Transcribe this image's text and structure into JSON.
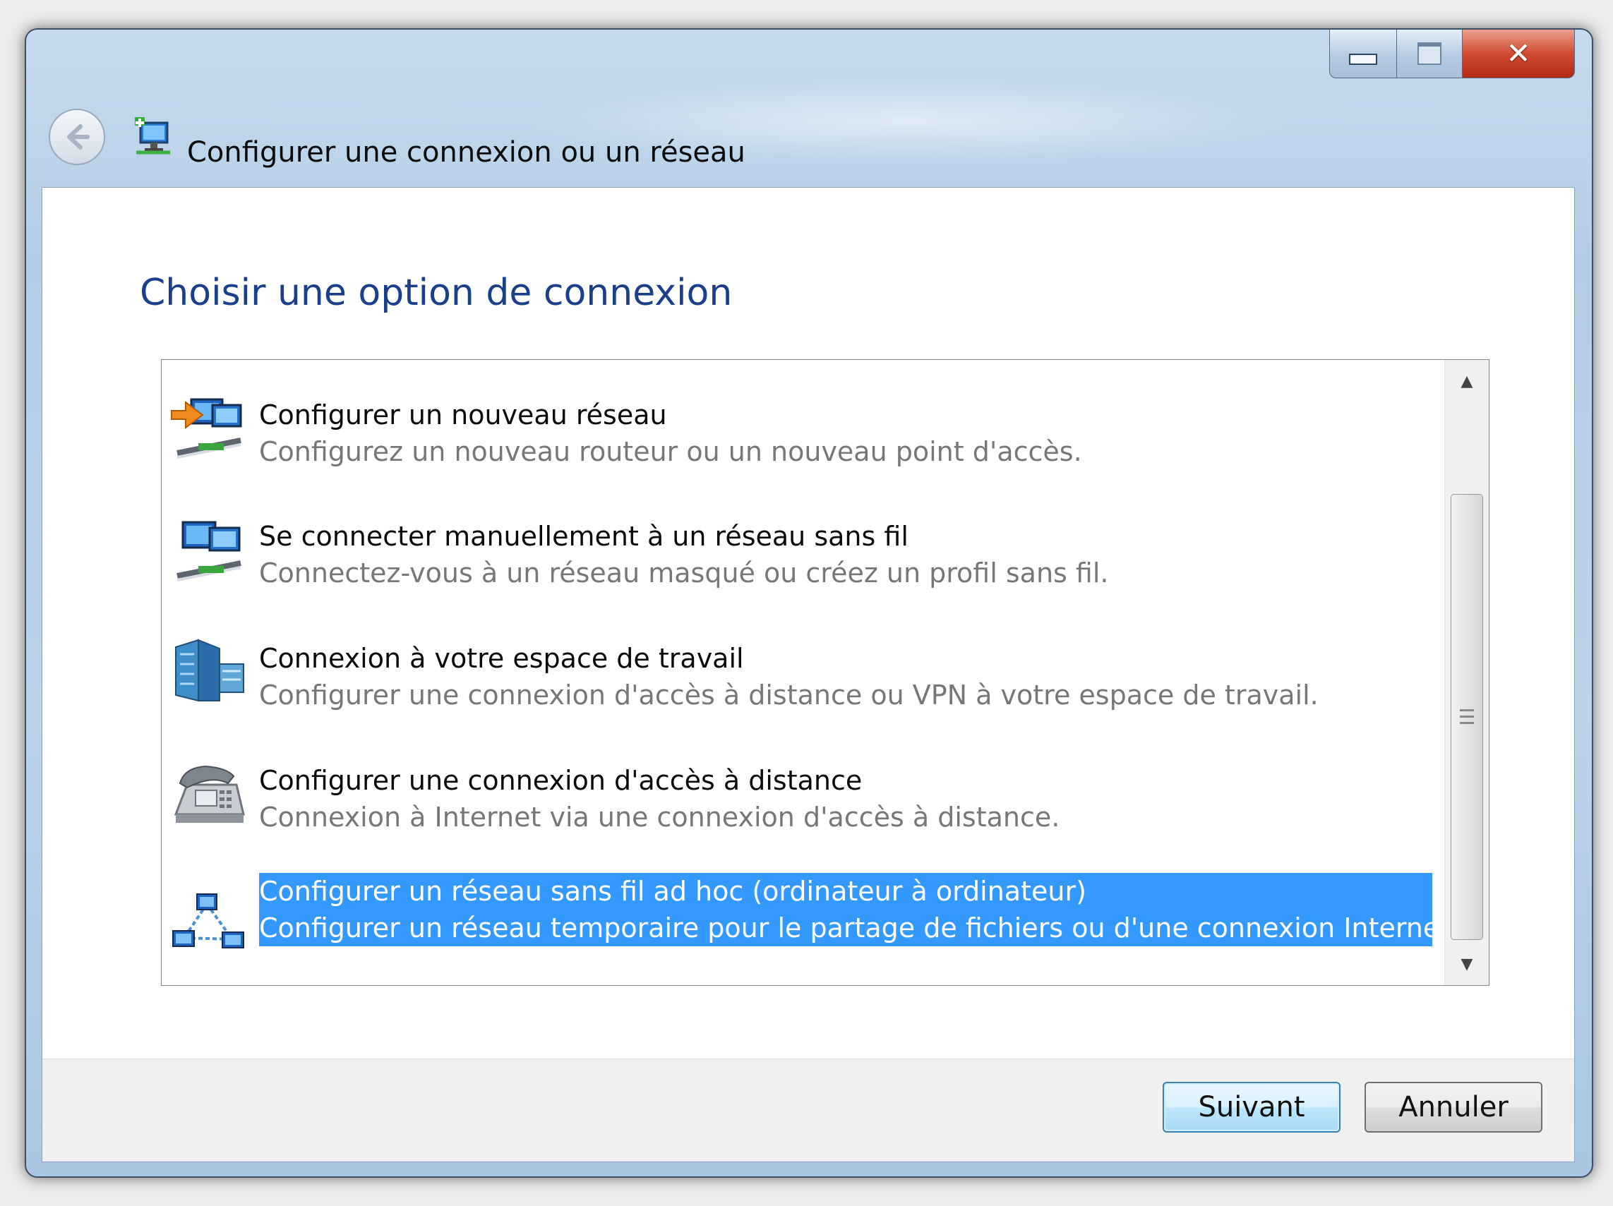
{
  "window": {
    "title": "Configurer une connexion ou un réseau",
    "controls": {
      "minimize": "minimize",
      "maximize": "maximize",
      "close": "✕"
    }
  },
  "heading": "Choisir une option de connexion",
  "options": [
    {
      "title": "Configurer un nouveau réseau",
      "description": "Configurez un nouveau routeur ou un nouveau point d'accès.",
      "icon": "new-network-icon",
      "selected": false
    },
    {
      "title": "Se connecter manuellement à un réseau sans fil",
      "description": "Connectez-vous à un réseau masqué ou créez un profil sans fil.",
      "icon": "wireless-network-icon",
      "selected": false
    },
    {
      "title": "Connexion à votre espace de travail",
      "description": "Configurer une connexion d'accès à distance ou VPN à votre espace de travail.",
      "icon": "workplace-icon",
      "selected": false
    },
    {
      "title": "Configurer une connexion d'accès à distance",
      "description": "Connexion à Internet via une connexion d'accès à distance.",
      "icon": "phone-icon",
      "selected": false
    },
    {
      "title": "Configurer un réseau sans fil ad hoc (ordinateur à ordinateur)",
      "description": "Configurer un réseau temporaire pour le partage de fichiers ou d'une connexion Internet.",
      "icon": "adhoc-network-icon",
      "selected": true
    }
  ],
  "buttons": {
    "next": "Suivant",
    "cancel": "Annuler"
  },
  "colors": {
    "heading": "#1b3f8a",
    "selection": "#3399ff"
  }
}
